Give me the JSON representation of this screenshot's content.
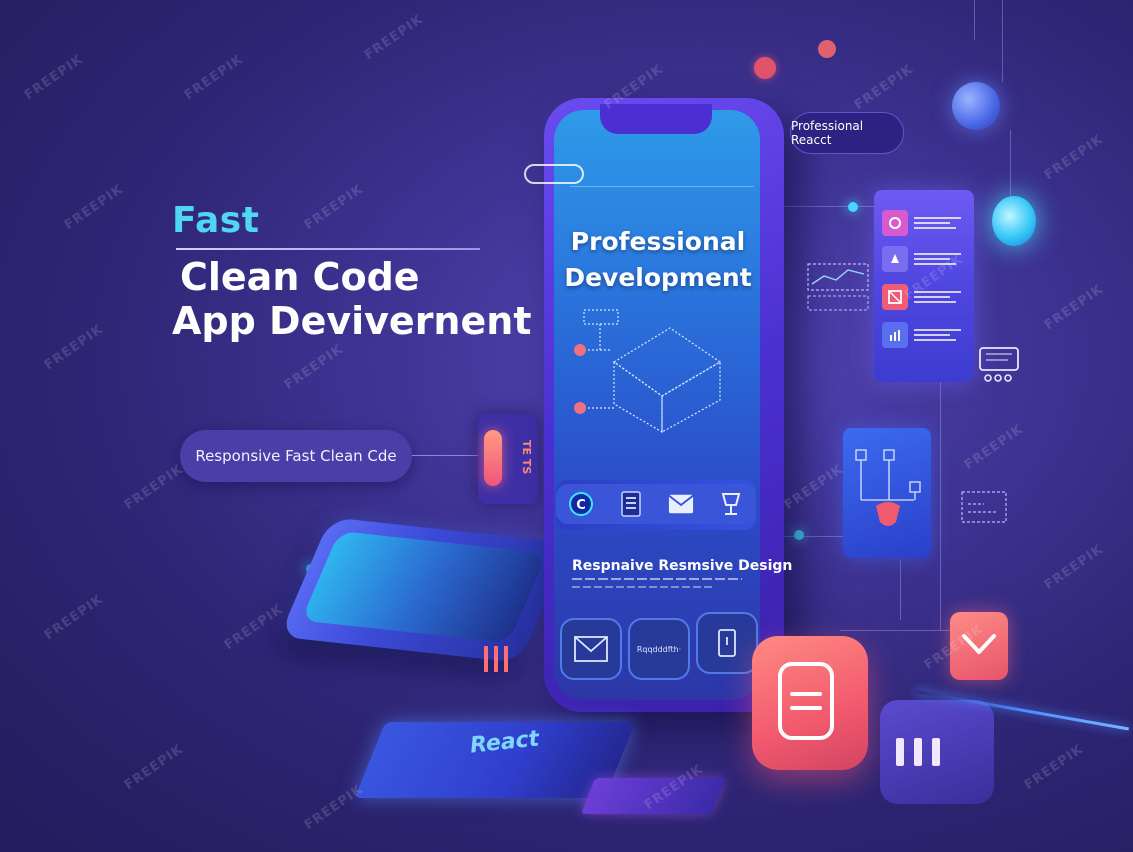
{
  "hero": {
    "fast": "Fast",
    "line1": "Clean Code",
    "line2": "App Devivernent"
  },
  "left_pill": {
    "label": "Responsive Fast Clean Cde"
  },
  "phone": {
    "title_line1": "Professional",
    "title_line2": "Development",
    "caption": "Respnaive Resmsive Design",
    "hex_label": "Rqqdddfth·"
  },
  "right_pill": {
    "label": "Professional Reacct"
  },
  "side_card": {
    "text": "TE TS"
  },
  "react_card": {
    "label": "React"
  },
  "watermark": {
    "text": "FREEPIK"
  },
  "colors": {
    "accent_cyan": "#4fd7f2",
    "accent_red": "#f25a6e",
    "bg_purple": "#3f3494"
  }
}
